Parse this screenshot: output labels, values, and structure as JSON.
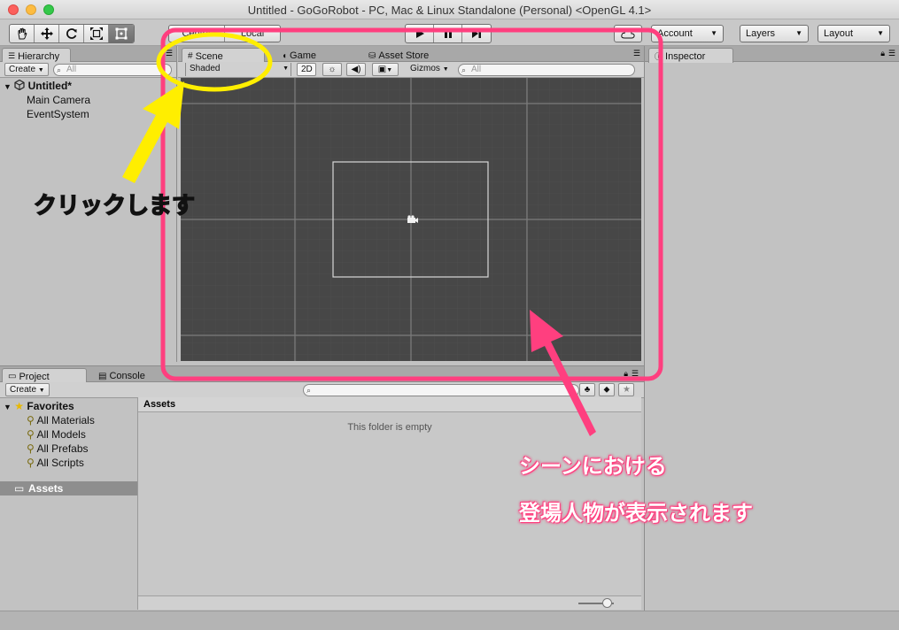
{
  "window": {
    "title": "Untitled - GoGoRobot - PC, Mac & Linux Standalone (Personal) <OpenGL 4.1>"
  },
  "toolbar": {
    "tools": [
      "hand-tool",
      "move-tool",
      "rotate-tool",
      "scale-tool",
      "rect-tool"
    ],
    "pivot_label": "Center",
    "space_label": "Local",
    "account_label": "Account",
    "layers_label": "Layers",
    "layout_label": "Layout"
  },
  "hierarchy": {
    "tab_label": "Hierarchy",
    "create_label": "Create",
    "search_placeholder": "All",
    "scene_name": "Untitled*",
    "items": [
      "Main Camera",
      "EventSystem"
    ]
  },
  "scene_panel": {
    "tabs": [
      "Scene",
      "Game",
      "Asset Store"
    ],
    "shading_label": "Shaded",
    "mode_2d_label": "2D",
    "gizmos_label": "Gizmos",
    "search_placeholder": "All"
  },
  "inspector": {
    "tab_label": "Inspector"
  },
  "project": {
    "tabs": [
      "Project",
      "Console"
    ],
    "create_label": "Create",
    "favorites_label": "Favorites",
    "favorites": [
      "All Materials",
      "All Models",
      "All Prefabs",
      "All Scripts"
    ],
    "assets_label": "Assets",
    "assets_header": "Assets",
    "empty_message": "This folder is empty"
  },
  "annotations": {
    "click_label": "クリックします",
    "scene_line1": "シーンにおける",
    "scene_line2": "登場人物が表示されます"
  },
  "colors": {
    "highlight_pink": "#ff3f7f",
    "highlight_yellow": "#ffee00",
    "scene_bg": "#474747"
  }
}
